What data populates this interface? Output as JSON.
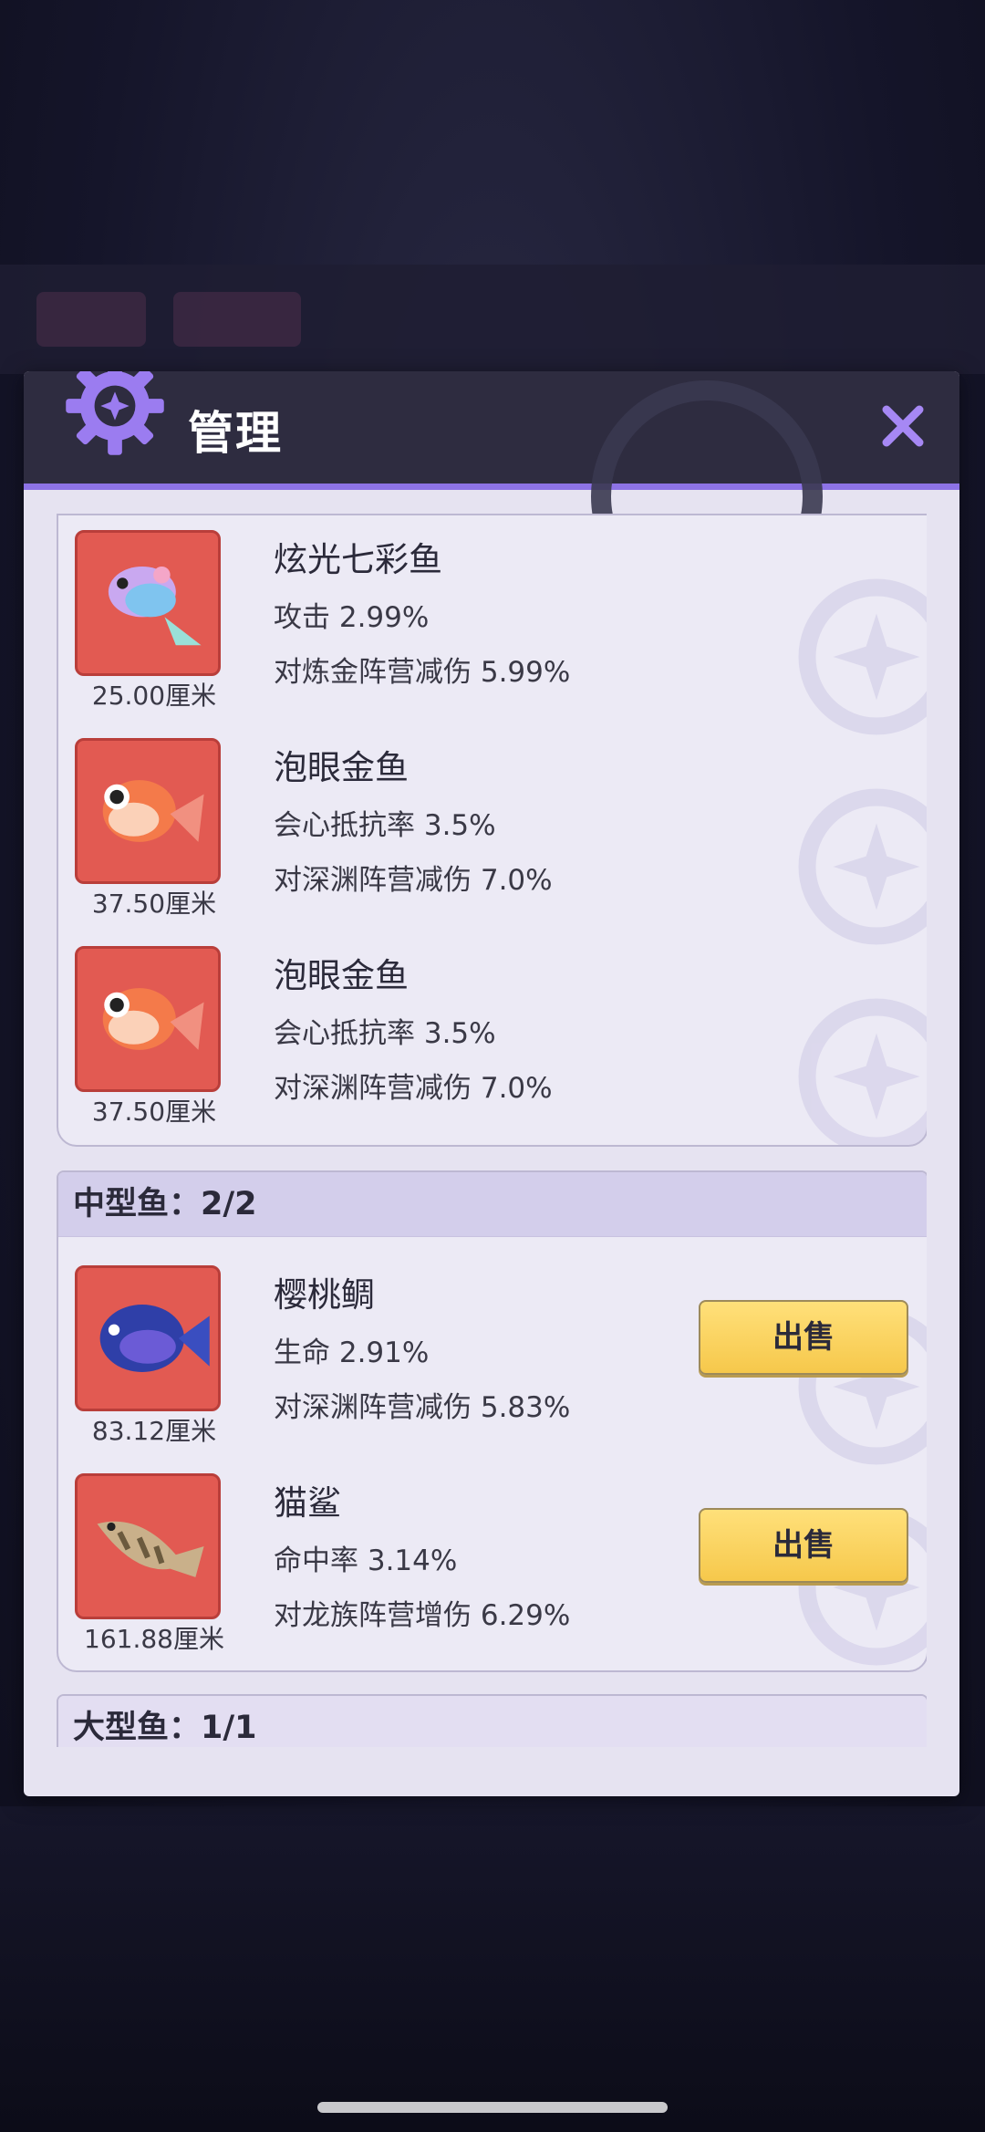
{
  "dialog": {
    "title": "管理",
    "close_label": "✕"
  },
  "top_section": {
    "fish": [
      {
        "name": "炫光七彩鱼",
        "stat1": "攻击 2.99%",
        "stat2": "对炼金阵营减伤 5.99%",
        "size": "25.00厘米",
        "icon": "rainbow-fish-icon"
      },
      {
        "name": "泡眼金鱼",
        "stat1": "会心抵抗率 3.5%",
        "stat2": "对深渊阵营减伤 7.0%",
        "size": "37.50厘米",
        "icon": "goldfish-icon"
      },
      {
        "name": "泡眼金鱼",
        "stat1": "会心抵抗率 3.5%",
        "stat2": "对深渊阵营减伤 7.0%",
        "size": "37.50厘米",
        "icon": "goldfish-icon"
      }
    ]
  },
  "medium_section": {
    "header": "中型鱼：2/2",
    "fish": [
      {
        "name": "樱桃鲷",
        "stat1": "生命 2.91%",
        "stat2": "对深渊阵营减伤 5.83%",
        "size": "83.12厘米",
        "sell_label": "出售",
        "icon": "blue-fish-icon"
      },
      {
        "name": "猫鲨",
        "stat1": "命中率 3.14%",
        "stat2": "对龙族阵营增伤 6.29%",
        "size": "161.88厘米",
        "sell_label": "出售",
        "icon": "shark-icon"
      }
    ]
  },
  "large_section": {
    "header": "大型鱼：1/1"
  },
  "colors": {
    "accent": "#8d73e6",
    "header_bg": "#2e2c40",
    "panel_bg": "#e6e3f1",
    "sell_button": "#f6c84b",
    "fish_tile": "#e25a52"
  }
}
